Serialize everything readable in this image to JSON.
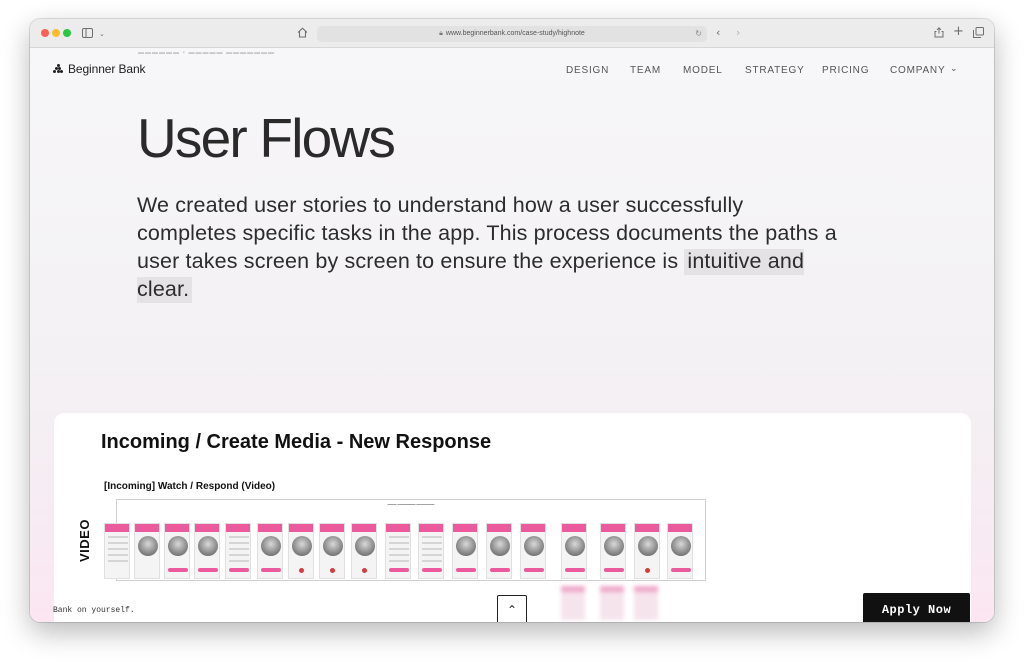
{
  "browser": {
    "url": "www.beginnerbank.com/case-study/highnote",
    "icons": {
      "sidebar": "sidebar-icon",
      "home": "home-icon",
      "lock": "lock-icon",
      "reload": "reload-icon",
      "back": "chevron-left-icon",
      "forward": "chevron-right-icon",
      "share": "share-icon",
      "new_tab": "plus-icon",
      "tabs": "tabs-icon"
    }
  },
  "header": {
    "logo_text": "Beginner Bank",
    "nav": [
      "DESIGN",
      "TEAM",
      "MODEL",
      "STRATEGY",
      "PRICING",
      "COMPANY"
    ]
  },
  "main": {
    "title": "User Flows",
    "paragraph": "We created user stories to understand how a user successfully completes specific tasks in the app. This process documents the paths a user takes screen by screen to ensure the experience is",
    "paragraph_highlight": "intuitive and clear."
  },
  "card": {
    "title": "Incoming / Create Media - New Response",
    "flow_label": "[Incoming] Watch  / Respond (Video)",
    "side_label": "VIDEO"
  },
  "footer": {
    "tagline": "Bank on yourself.",
    "apply_label": "Apply Now"
  },
  "colors": {
    "accent_pink": "#ea5a9d",
    "button_dark": "#111111"
  }
}
